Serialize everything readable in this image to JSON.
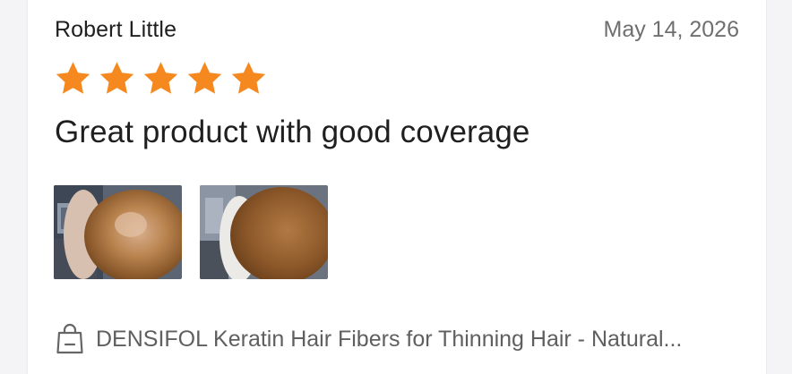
{
  "review": {
    "reviewer_name": "Robert Little",
    "date": "May 14, 2026",
    "rating": 5,
    "rating_max": 5,
    "headline": "Great product with good coverage",
    "photos": [
      {
        "icon": "review-photo-before"
      },
      {
        "icon": "review-photo-after"
      }
    ],
    "product": {
      "icon": "shopping-bag-icon",
      "name": "DENSIFOL Keratin Hair Fibers for Thinning Hair - Natural..."
    }
  },
  "colors": {
    "star": "#f5891f",
    "text_primary": "#1f1f1f",
    "text_secondary": "#6f6f6f"
  }
}
